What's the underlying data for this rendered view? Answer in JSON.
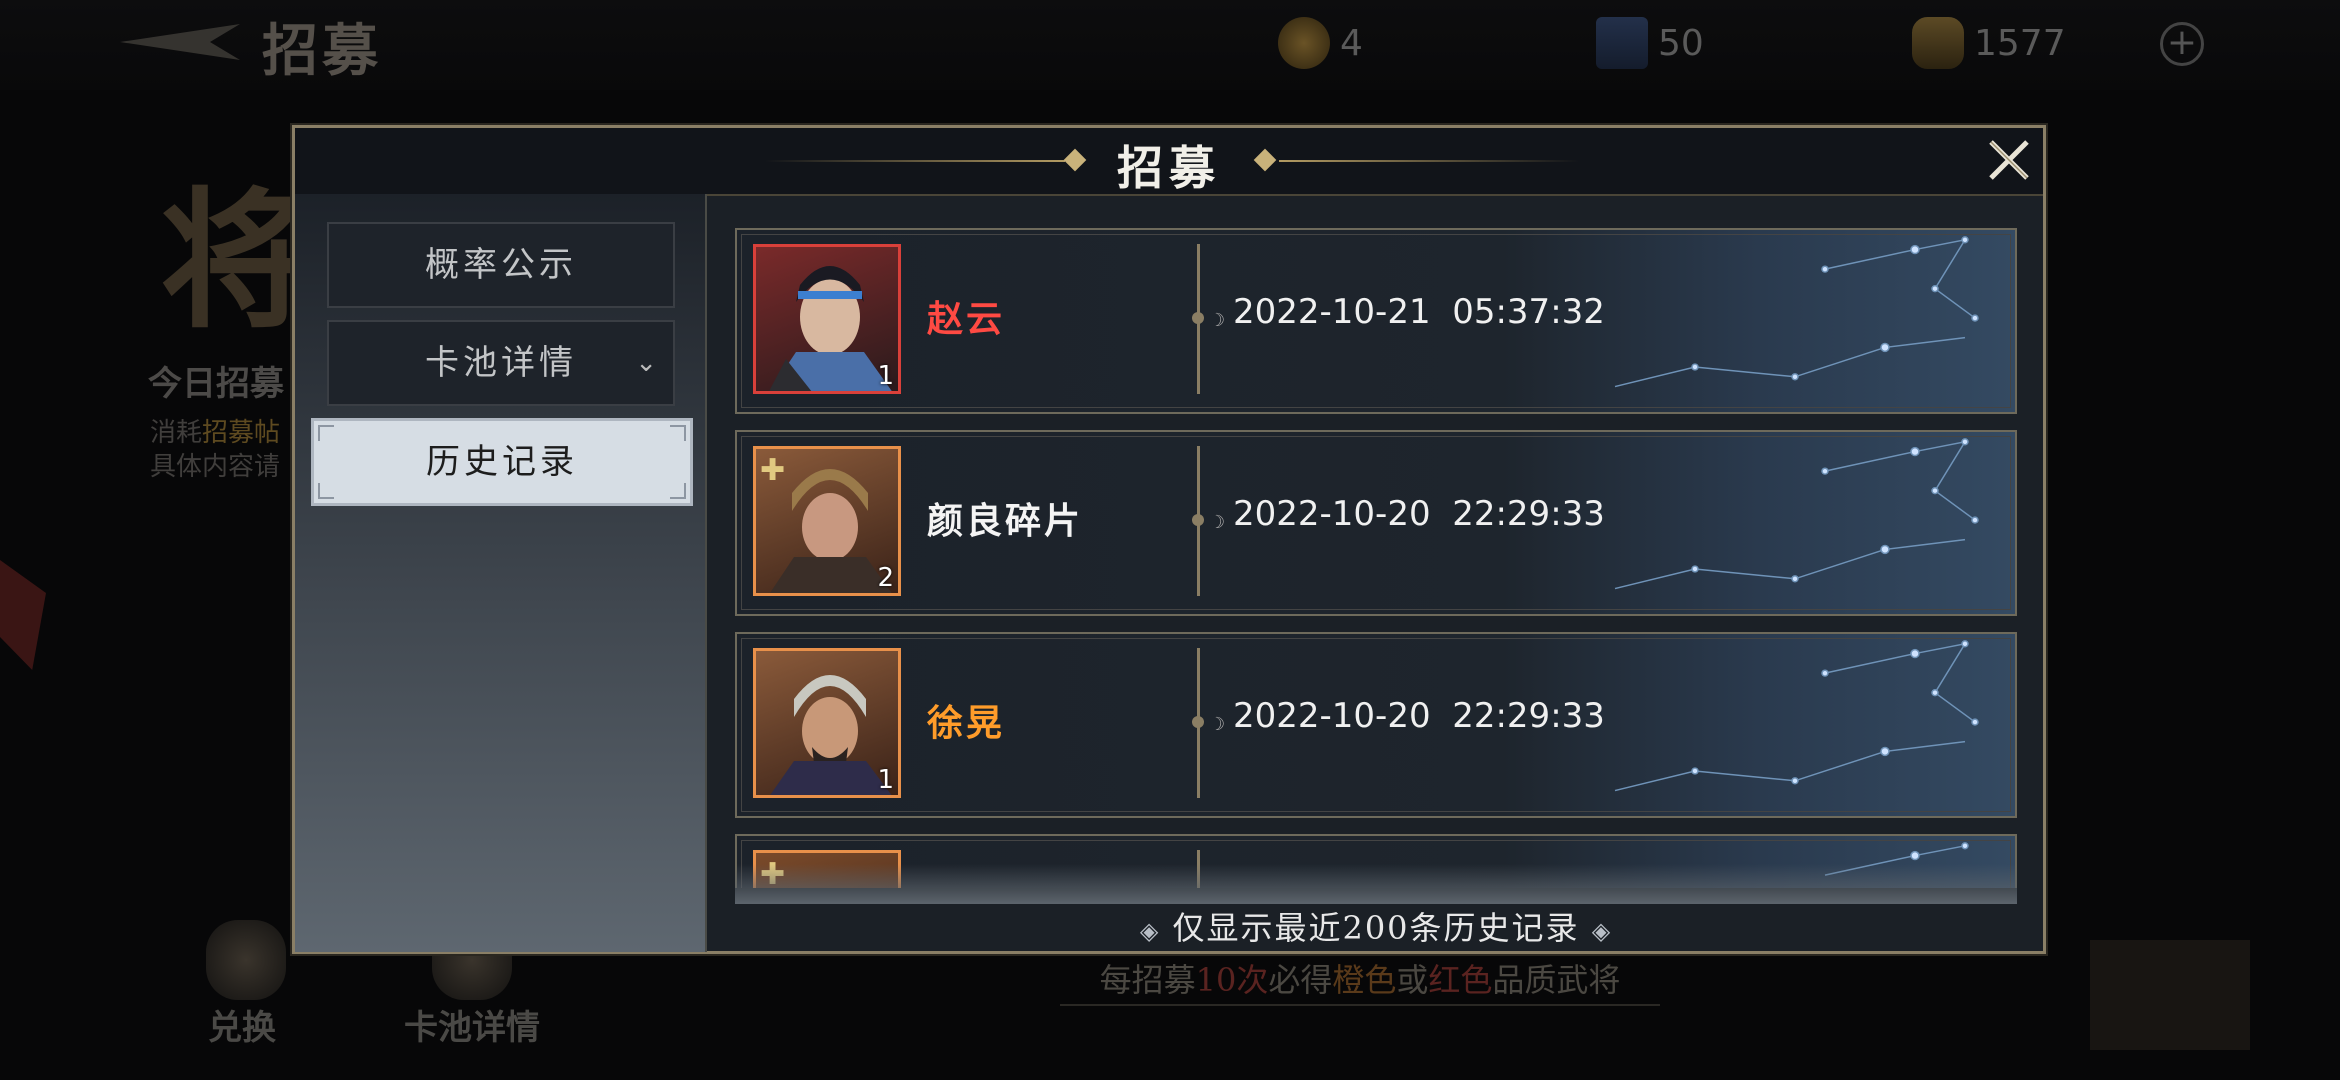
{
  "background": {
    "title": "招募",
    "resources": [
      {
        "name": "token-icon",
        "value": "4"
      },
      {
        "name": "scroll-icon",
        "value": "50"
      },
      {
        "name": "gold-icon",
        "value": "1577"
      }
    ],
    "big_char": "将",
    "today_label": "今日招募",
    "line1_a": "消耗",
    "line1_b": "招募帖",
    "line2": "具体内容请",
    "bottom_buttons": [
      "兑换",
      "卡池详情"
    ],
    "banner": {
      "a": "每招募",
      "b": "10次",
      "c": "必得",
      "d": "橙色",
      "e": "或",
      "f": "红色",
      "g": "品质武将"
    }
  },
  "modal": {
    "title": "招募",
    "sidebar": [
      {
        "label": "概率公示",
        "active": false
      },
      {
        "label": "卡池详情",
        "active": false,
        "has_dropdown": true
      },
      {
        "label": "历史记录",
        "active": true
      }
    ],
    "records": [
      {
        "name": "赵云",
        "name_color": "#ff4a43",
        "count": "1",
        "fragment": false,
        "timestamp": "2022-10-21  05:37:32",
        "frame_color": "#d9403a"
      },
      {
        "name": "颜良碎片",
        "name_color": "#f4f4f4",
        "count": "2",
        "fragment": true,
        "timestamp": "2022-10-20  22:29:33",
        "frame_color": "#e8904a"
      },
      {
        "name": "徐晃",
        "name_color": "#ff9c2a",
        "count": "1",
        "fragment": false,
        "timestamp": "2022-10-20  22:29:33",
        "frame_color": "#e8904a"
      },
      {
        "name": "",
        "name_color": "#f4f4f4",
        "count": "",
        "fragment": true,
        "timestamp": "",
        "frame_color": "#e8904a"
      }
    ],
    "footer_note": "仅显示最近200条历史记录"
  }
}
